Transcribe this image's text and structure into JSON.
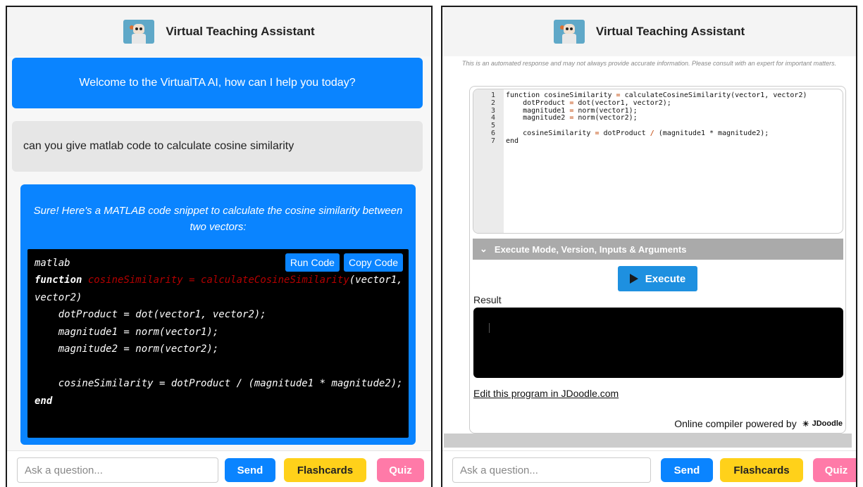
{
  "app": {
    "title": "Virtual Teaching Assistant"
  },
  "left": {
    "welcome": "Welcome to the VirtualTA AI, how can I help you today?",
    "user_message": "can you give matlab code to calculate cosine similarity",
    "answer_lead": "Sure! Here's a MATLAB code snippet to calculate the cosine similarity between two vectors:",
    "code": {
      "language": "matlab",
      "run_label": "Run Code",
      "copy_label": "Copy Code",
      "kw_function": "function",
      "name_var": "cosineSimilarity",
      "eq": " = ",
      "name_fn": "calculateCosineSimilarity",
      "args": "(vector1, vector2)",
      "body": "    dotProduct = dot(vector1, vector2);\n    magnitude1 = norm(vector1);\n    magnitude2 = norm(vector2);\n\n    cosineSimilarity = dotProduct / (magnitude1 * magnitude2);",
      "kw_end": "end"
    }
  },
  "right": {
    "disclaimer": "This is an automated response and may not always provide accurate information. Please consult with an expert for important matters.",
    "editor": {
      "line_numbers": "1\n2\n3\n4\n5\n6\n7",
      "line1_a": "function cosineSimilarity ",
      "line1_b": "=",
      "line1_c": " calculateCosineSimilarity(vector1, vector2)",
      "line2_a": "    dotProduct ",
      "line2_c": " dot(vector1, vector2);",
      "line3_a": "    magnitude1 ",
      "line3_c": " norm(vector1);",
      "line4_a": "    magnitude2 ",
      "line4_c": " norm(vector2);",
      "line6_a": "    cosineSimilarity ",
      "line6_c": " dotProduct ",
      "line6_d": "/",
      "line6_e": " (magnitude1 * magnitude2);",
      "line7": "end"
    },
    "exec_bar": "Execute Mode, Version, Inputs & Arguments",
    "execute_label": "Execute",
    "result_label": "Result",
    "edit_link": "Edit this program in JDoodle.com",
    "powered": "Online compiler powered by",
    "jdoodle": "JDoodle"
  },
  "footer": {
    "placeholder": "Ask a question...",
    "send": "Send",
    "flashcards": "Flashcards",
    "quiz": "Quiz"
  },
  "colors": {
    "accent": "#0a84ff",
    "flashcards": "#ffd11a",
    "quiz": "#ff7aa8",
    "code_bg": "#000000",
    "error_red": "#b30000"
  }
}
